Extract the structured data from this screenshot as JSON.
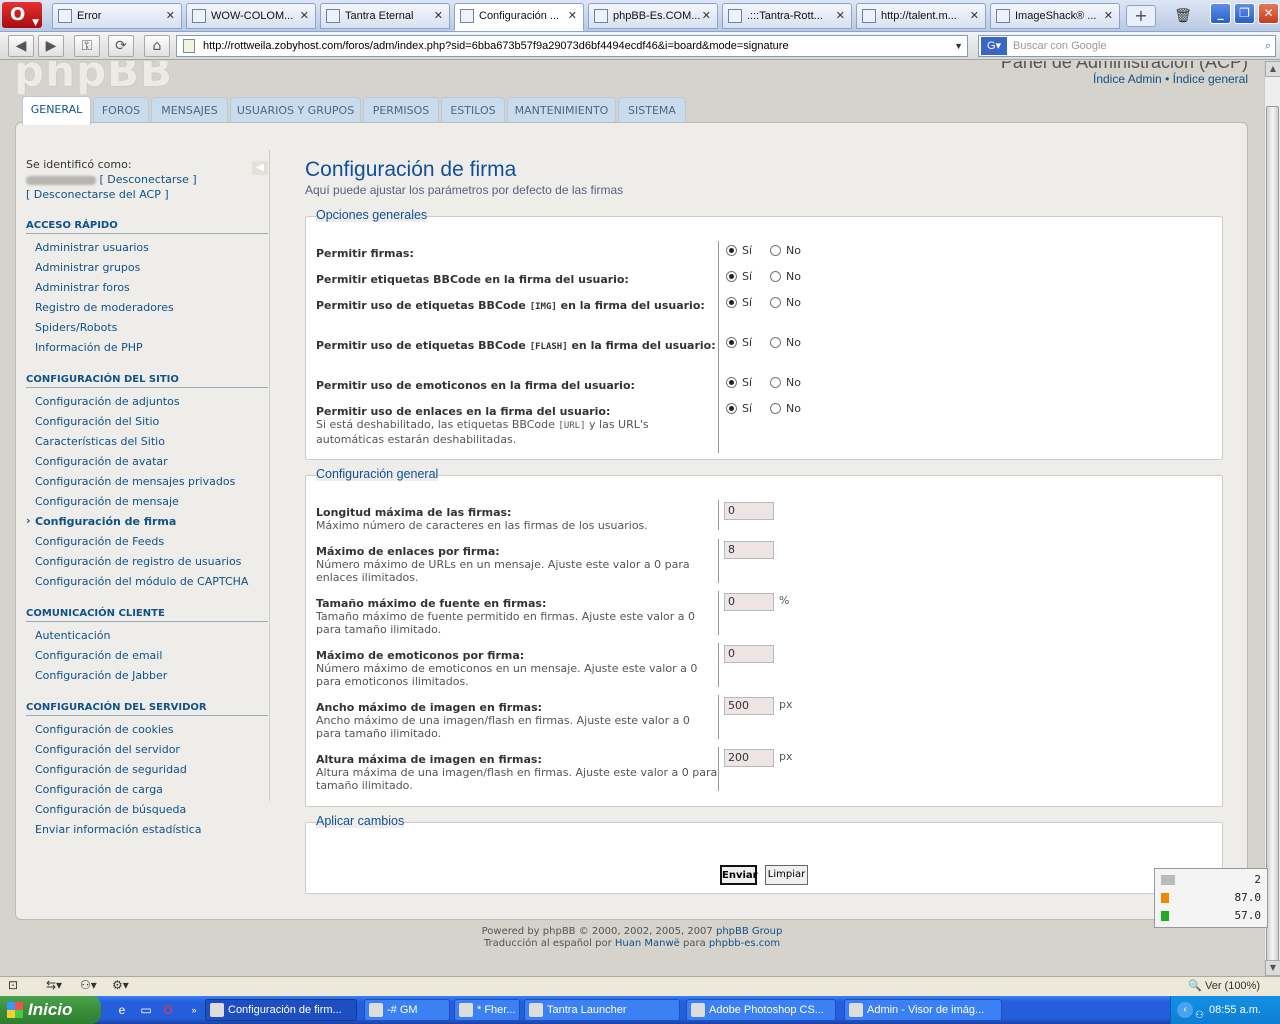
{
  "browser": {
    "tabs": [
      {
        "label": "Error"
      },
      {
        "label": "WOW-COLOM..."
      },
      {
        "label": "Tantra Eternal"
      },
      {
        "label": "Configuración ..."
      },
      {
        "label": "phpBB-Es.COM..."
      },
      {
        "label": ".:::Tantra-Rott..."
      },
      {
        "label": "http://talent.m..."
      },
      {
        "label": "ImageShack® ..."
      }
    ],
    "active_tab": 3,
    "address": "http://rottweila.zobyhost.com/foros/adm/index.php?sid=6bba673b57f9a29073d6bf4494ecdf46&i=board&mode=signature",
    "search_placeholder": "Buscar con Google",
    "zoom": "Ver (100%)"
  },
  "header": {
    "panel_title": "Panel de Administración (ACP)",
    "link_admin": "Índice Admin",
    "separator": "•",
    "link_index": "Índice general"
  },
  "main_tabs": [
    {
      "label": "GENERAL"
    },
    {
      "label": "FOROS"
    },
    {
      "label": "MENSAJES"
    },
    {
      "label": "USUARIOS Y GRUPOS"
    },
    {
      "label": "PERMISOS"
    },
    {
      "label": "ESTILOS"
    },
    {
      "label": "MANTENIMIENTO"
    },
    {
      "label": "SISTEMA"
    }
  ],
  "sidebar": {
    "logged_as": "Se identificó como:",
    "logout": "[ Desconectarse ]",
    "logout_acp": "[ Desconectarse del ACP ]",
    "sections": [
      {
        "title": "ACCESO RÁPIDO",
        "items": [
          "Administrar usuarios",
          "Administrar grupos",
          "Administrar foros",
          "Registro de moderadores",
          "Spiders/Robots",
          "Información de PHP"
        ]
      },
      {
        "title": "CONFIGURACIÓN DEL SITIO",
        "items": [
          "Configuración de adjuntos",
          "Configuración del Sitio",
          "Características del Sitio",
          "Configuración de avatar",
          "Configuración de mensajes privados",
          "Configuración de mensaje",
          "Configuración de firma",
          "Configuración de Feeds",
          "Configuración de registro de usuarios",
          "Configuración del módulo de CAPTCHA"
        ]
      },
      {
        "title": "COMUNICACIÓN CLIENTE",
        "items": [
          "Autenticación",
          "Configuración de email",
          "Configuración de Jabber"
        ]
      },
      {
        "title": "CONFIGURACIÓN DEL SERVIDOR",
        "items": [
          "Configuración de cookies",
          "Configuración del servidor",
          "Configuración de seguridad",
          "Configuración de carga",
          "Configuración de búsqueda",
          "Enviar información estadística"
        ]
      }
    ],
    "active_item": "Configuración de firma"
  },
  "main": {
    "title": "Configuración de firma",
    "subtitle": "Aquí puede ajustar los parámetros por defecto de las firmas",
    "general_options": {
      "legend": "Opciones generales",
      "yes": "Sí",
      "no": "No",
      "rows": [
        {
          "l1": "Permitir firmas:",
          "value": "Sí"
        },
        {
          "l1": "Permitir etiquetas BBCode en la firma del usuario:",
          "value": "Sí"
        },
        {
          "l1": "Permitir uso de etiquetas BBCode",
          "code": "[IMG]",
          "l2": "en la firma del usuario:",
          "value": "Sí"
        },
        {
          "l1": "Permitir uso de etiquetas BBCode",
          "code": "[FLASH]",
          "l2": "en la firma del usuario:",
          "value": "Sí"
        },
        {
          "l1": "Permitir uso de emoticonos en la firma del usuario:",
          "value": "Sí"
        },
        {
          "l1": "Permitir uso de enlaces en la firma del usuario:",
          "exp1": "Si está deshabilitado, las etiquetas BBCode",
          "code": "[URL]",
          "exp2": "y las URL's automáticas estarán deshabilitadas.",
          "value": "Sí"
        }
      ]
    },
    "general_config": {
      "legend": "Configuración general",
      "rows": [
        {
          "label": "Longitud máxima de las firmas:",
          "explain": "Máximo número de caracteres en las firmas de los usuarios.",
          "value": "0",
          "unit": ""
        },
        {
          "label": "Máximo de enlaces por firma:",
          "explain": "Número máximo de URLs en un mensaje. Ajuste este valor a 0 para enlaces ilimitados.",
          "value": "8",
          "unit": ""
        },
        {
          "label": "Tamaño máximo de fuente en firmas:",
          "explain": "Tamaño máximo de fuente permitido en firmas. Ajuste este valor a 0 para tamaño ilimitado.",
          "value": "0",
          "unit": "%"
        },
        {
          "label": "Máximo de emoticonos por firma:",
          "explain": "Número máximo de emoticonos en un mensaje. Ajuste este valor a 0 para emoticonos ilimitados.",
          "value": "0",
          "unit": ""
        },
        {
          "label": "Ancho máximo de imagen en firmas:",
          "explain": "Ancho máximo de una imagen/flash en firmas. Ajuste este valor a 0 para tamaño ilimitado.",
          "value": "500",
          "unit": "px"
        },
        {
          "label": "Altura máxima de imagen en firmas:",
          "explain": "Altura máxima de una imagen/flash en firmas. Ajuste este valor a 0 para tamaño ilimitado.",
          "value": "200",
          "unit": "px"
        }
      ]
    },
    "apply": {
      "legend": "Aplicar cambios",
      "submit": "Enviar",
      "reset": "Limpiar"
    }
  },
  "footer": {
    "powered": "Powered by",
    "phpbb": "phpBB",
    "copyright": "© 2000, 2002, 2005, 2007",
    "group": "phpBB Group",
    "translation": "Traducción al español por",
    "translator": "Huan Manwë",
    "para": "para",
    "site": "phpbb-es.com"
  },
  "widget": {
    "v1": "2",
    "v2": "87.0",
    "v3": "57.0"
  },
  "taskbar": {
    "start": "Inicio",
    "tasks": [
      "Configuración de firm...",
      "-#  GM",
      "* Fher...",
      "Tantra Launcher",
      "Adobe Photoshop CS...",
      "Admin - Visor de imág..."
    ],
    "time": "08:55 a.m."
  }
}
